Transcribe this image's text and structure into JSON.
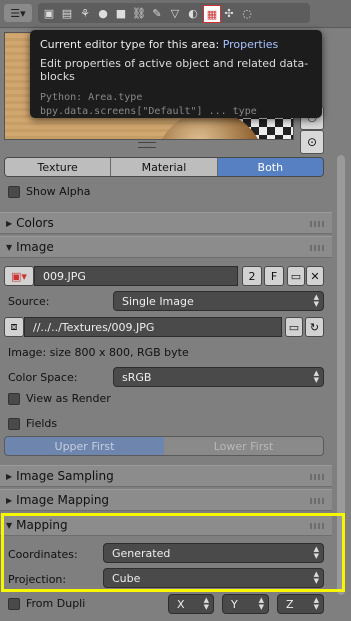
{
  "tooltip": {
    "title_prefix": "Current editor type for this area:",
    "title_value": "Properties",
    "description": "Edit properties of active object and related data-blocks",
    "python_line1": "Python: Area.type",
    "python_line2": "bpy.data.screens[\"Default\"] ... type"
  },
  "tabs": [
    "Texture",
    "Material",
    "Both"
  ],
  "active_tab": "Both",
  "show_alpha": "Show Alpha",
  "panels": {
    "colors": "Colors",
    "image": "Image",
    "image_sampling": "Image Sampling",
    "image_mapping": "Image Mapping",
    "mapping": "Mapping"
  },
  "image": {
    "name": "009.JPG",
    "users": "2",
    "fake_user": "F",
    "source_label": "Source:",
    "source_value": "Single Image",
    "filepath": "//../../Textures/009.JPG",
    "info": "Image: size 800 x 800, RGB byte",
    "color_space_label": "Color Space:",
    "color_space_value": "sRGB",
    "view_as_render": "View as Render",
    "fields": "Fields",
    "upper_first": "Upper First",
    "lower_first": "Lower First"
  },
  "mapping": {
    "coordinates_label": "Coordinates:",
    "coordinates_value": "Generated",
    "projection_label": "Projection:",
    "projection_value": "Cube",
    "from_dupli": "From Dupli",
    "x": "X",
    "y": "Y",
    "z": "Z"
  },
  "colors": {
    "highlight": "#f7f700",
    "accent": "#5680c2"
  }
}
